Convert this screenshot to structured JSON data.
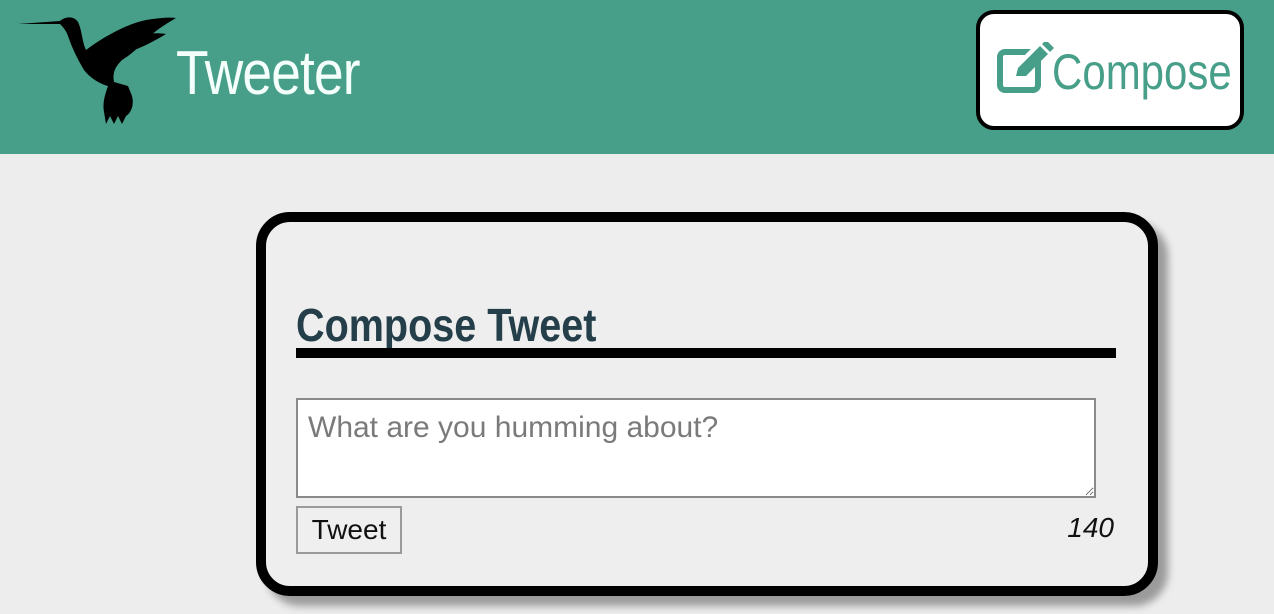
{
  "nav": {
    "brand": "Tweeter",
    "logo_icon": "hummingbird-icon",
    "compose_icon": "pencil-square-icon",
    "compose_label": "Compose",
    "background": "#489f89",
    "accent": "#489f89"
  },
  "composer": {
    "title": "Compose Tweet",
    "placeholder": "What are you humming about?",
    "value": "",
    "submit_label": "Tweet",
    "char_counter": "140",
    "title_color": "#243e4a"
  }
}
